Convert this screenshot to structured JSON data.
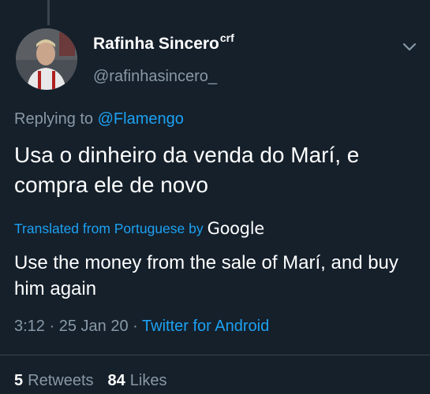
{
  "author": {
    "display_name": "Rafinha Sincero",
    "name_superscript": "crf",
    "handle": "@rafinhasincero_"
  },
  "reply": {
    "prefix": "Replying to",
    "mention": "@Flamengo"
  },
  "tweet": {
    "text": "Usa o dinheiro da venda do Marí, e compra ele de novo"
  },
  "translation": {
    "label": "Translated from Portuguese by",
    "provider": "Google",
    "text": "Use the money from the sale of Marí, and buy him again"
  },
  "meta": {
    "time": "3:12",
    "sep1": "·",
    "date": "25 Jan 20",
    "sep2": "·",
    "source": "Twitter for Android"
  },
  "stats": {
    "retweets_count": "5",
    "retweets_label": "Retweets",
    "likes_count": "84",
    "likes_label": "Likes"
  },
  "icons": {
    "menu": "chevron-down-icon"
  },
  "colors": {
    "background": "#15202b",
    "accent": "#1da1f2",
    "secondary_text": "#8899a6",
    "primary_text": "#ffffff"
  }
}
